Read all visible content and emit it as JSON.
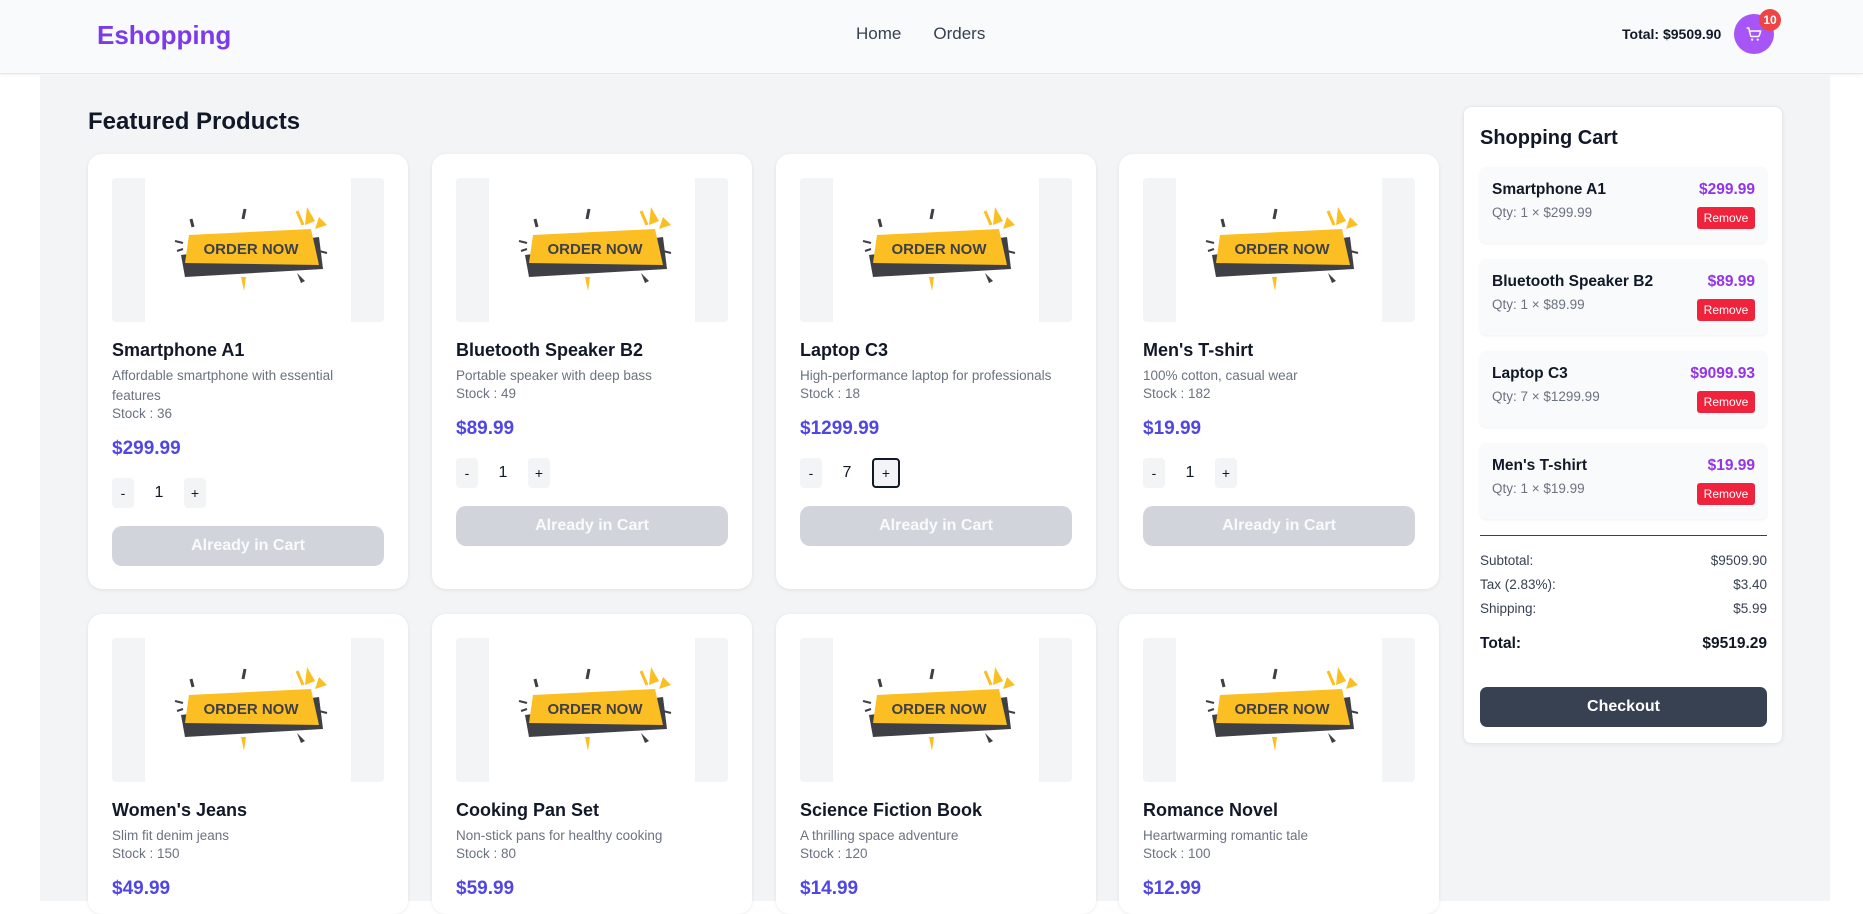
{
  "header": {
    "brand": "Eshopping",
    "nav": [
      "Home",
      "Orders"
    ],
    "total": "Total: $9509.90",
    "cart_count": "10",
    "cart_icon": "cart-icon"
  },
  "main": {
    "section_title": "Featured Products",
    "product_image_text": "ORDER NOW",
    "products": [
      {
        "name": "Smartphone A1",
        "desc": "Affordable smartphone with essential features",
        "stock": "Stock : 36",
        "price": "$299.99",
        "qty": "1",
        "button": "Already in Cart"
      },
      {
        "name": "Bluetooth Speaker B2",
        "desc": "Portable speaker with deep bass",
        "stock": "Stock : 49",
        "price": "$89.99",
        "qty": "1",
        "button": "Already in Cart"
      },
      {
        "name": "Laptop C3",
        "desc": "High-performance laptop for professionals",
        "stock": "Stock : 18",
        "price": "$1299.99",
        "qty": "7",
        "button": "Already in Cart"
      },
      {
        "name": "Men's T-shirt",
        "desc": "100% cotton, casual wear",
        "stock": "Stock : 182",
        "price": "$19.99",
        "qty": "1",
        "button": "Already in Cart"
      },
      {
        "name": "Women's Jeans",
        "desc": "Slim fit denim jeans",
        "stock": "Stock : 150",
        "price": "$49.99"
      },
      {
        "name": "Cooking Pan Set",
        "desc": "Non-stick pans for healthy cooking",
        "stock": "Stock : 80",
        "price": "$59.99"
      },
      {
        "name": "Science Fiction Book",
        "desc": "A thrilling space adventure",
        "stock": "Stock : 120",
        "price": "$14.99"
      },
      {
        "name": "Romance Novel",
        "desc": "Heartwarming romantic tale",
        "stock": "Stock : 100",
        "price": "$12.99"
      }
    ],
    "qty_minus": "-",
    "qty_plus": "+"
  },
  "cart": {
    "title": "Shopping Cart",
    "items": [
      {
        "name": "Smartphone A1",
        "qty": "Qty: 1 × $299.99",
        "price": "$299.99",
        "remove": "Remove"
      },
      {
        "name": "Bluetooth Speaker B2",
        "qty": "Qty: 1 × $89.99",
        "price": "$89.99",
        "remove": "Remove"
      },
      {
        "name": "Laptop C3",
        "qty": "Qty: 7 × $1299.99",
        "price": "$9099.93",
        "remove": "Remove"
      },
      {
        "name": "Men's T-shirt",
        "qty": "Qty: 1 × $19.99",
        "price": "$19.99",
        "remove": "Remove"
      }
    ],
    "subtotal_label": "Subtotal:",
    "subtotal": "$9509.90",
    "tax_label": "Tax (2.83%):",
    "tax": "$3.40",
    "shipping_label": "Shipping:",
    "shipping": "$5.99",
    "total_label": "Total:",
    "total": "$9519.29",
    "checkout": "Checkout"
  },
  "colors": {
    "brand": "#7c3aed",
    "price": "#4f46e5",
    "cart_price": "#9333ea",
    "remove": "#ef233c",
    "badge": "#ef4444",
    "checkout": "#374151",
    "banner_yellow": "#fbbf24",
    "banner_dark": "#3f3f46"
  }
}
